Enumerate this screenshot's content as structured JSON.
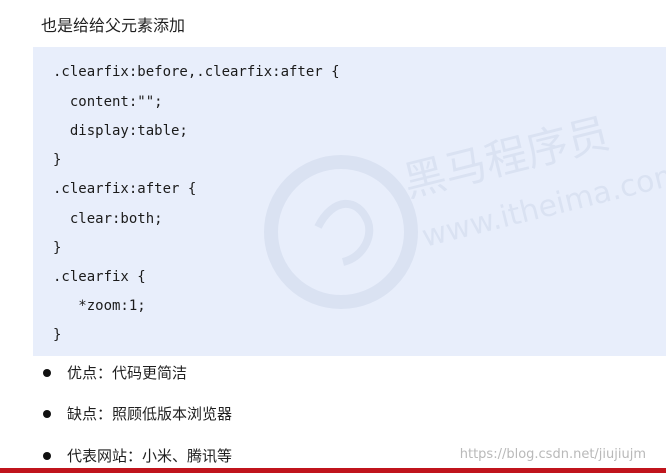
{
  "intro": "也是给给父元素添加",
  "code_lines": [
    ".clearfix:before,.clearfix:after {",
    "  content:\"\";",
    "  display:table;",
    "}",
    ".clearfix:after {",
    "  clear:both;",
    "}",
    ".clearfix {",
    "   *zoom:1;",
    "}"
  ],
  "bullets": [
    "优点：代码更简洁",
    "缺点：照顾低版本浏览器",
    "代表网站：小米、腾讯等"
  ],
  "watermark": {
    "logo_text": "黑马程序员",
    "url_text": "www.itheima.com"
  },
  "site_watermark": "https://blog.csdn.net/jiujiujm",
  "colors": {
    "code_bg": "#e8eefb",
    "bottom_bar": "#c0141c"
  }
}
